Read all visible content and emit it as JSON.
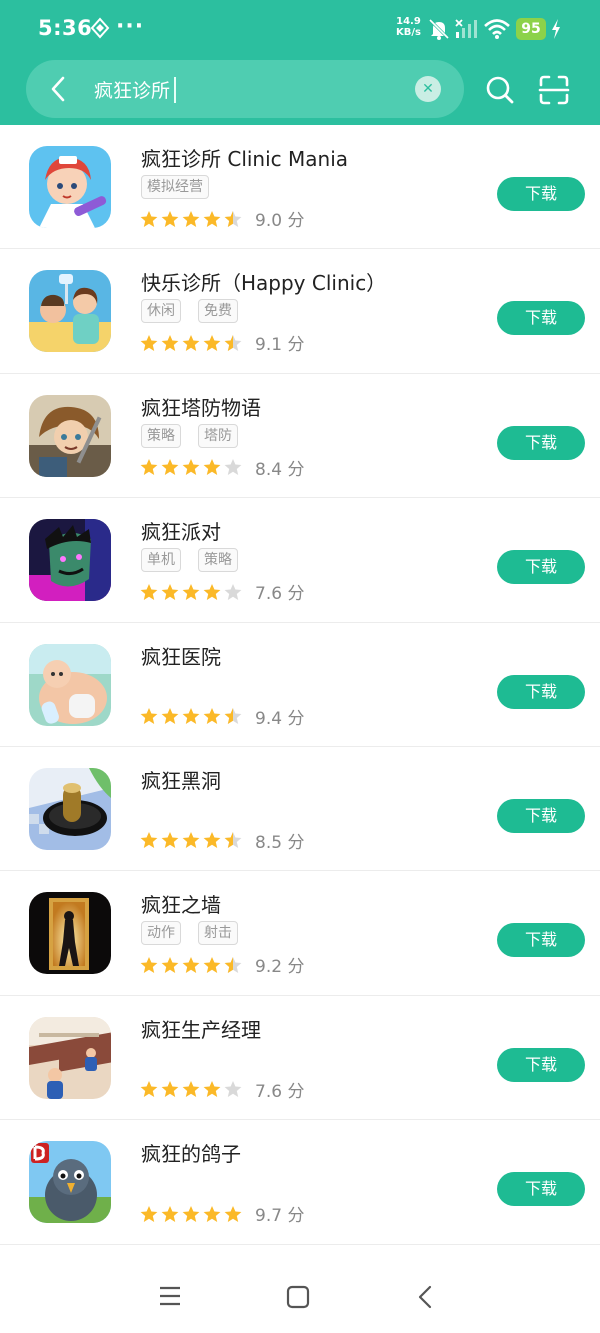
{
  "status": {
    "time": "5:36",
    "speed_value": "14.9",
    "speed_unit": "KB/s",
    "battery": "95"
  },
  "search": {
    "query": "疯狂诊所"
  },
  "colors": {
    "brand": "#2cbf9f",
    "button": "#1ebb93",
    "star": "#fbb928",
    "star_empty": "#d9d9d9"
  },
  "apps": [
    {
      "name": "疯狂诊所 Clinic Mania",
      "tags": [
        "模拟经营"
      ],
      "score": "9.0 分",
      "stars": 4.5,
      "button": "下载",
      "icon": "nurse-game-icon"
    },
    {
      "name": "快乐诊所（Happy Clinic）",
      "tags": [
        "休闲",
        "免费"
      ],
      "score": "9.1 分",
      "stars": 4.5,
      "button": "下载",
      "icon": "clinic-game-icon"
    },
    {
      "name": "疯狂塔防物语",
      "tags": [
        "策略",
        "塔防"
      ],
      "score": "8.4 分",
      "stars": 4,
      "button": "下载",
      "icon": "tower-defense-game-icon"
    },
    {
      "name": "疯狂派对",
      "tags": [
        "单机",
        "策略"
      ],
      "score": "7.6 分",
      "stars": 4,
      "button": "下载",
      "icon": "party-game-icon"
    },
    {
      "name": "疯狂医院",
      "tags": [],
      "score": "9.4 分",
      "stars": 4.5,
      "button": "下载",
      "icon": "hospital-game-icon"
    },
    {
      "name": "疯狂黑洞",
      "tags": [],
      "score": "8.5 分",
      "stars": 4.5,
      "button": "下载",
      "icon": "black-hole-game-icon"
    },
    {
      "name": "疯狂之墙",
      "tags": [
        "动作",
        "射击"
      ],
      "score": "9.2 分",
      "stars": 4.5,
      "button": "下载",
      "icon": "wall-game-icon"
    },
    {
      "name": "疯狂生产经理",
      "tags": [],
      "score": "7.6 分",
      "stars": 4,
      "button": "下载",
      "icon": "factory-game-icon"
    },
    {
      "name": "疯狂的鸽子",
      "tags": [],
      "score": "9.7 分",
      "stars": 5,
      "button": "下载",
      "icon": "pigeon-game-icon"
    }
  ]
}
